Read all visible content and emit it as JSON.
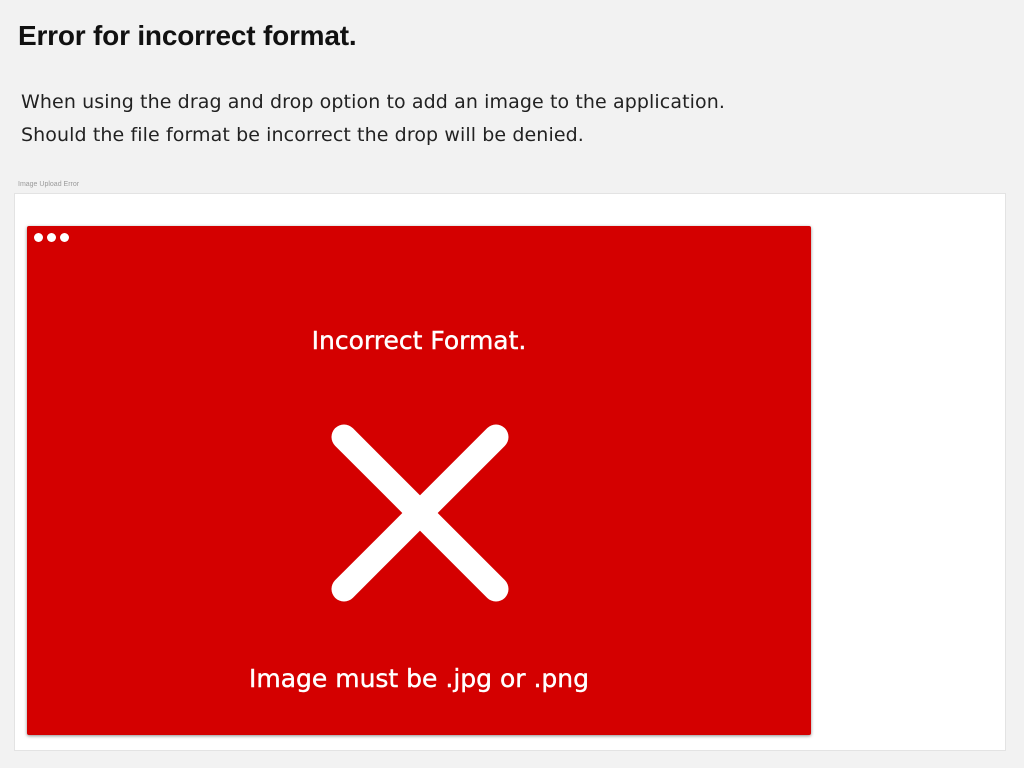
{
  "page": {
    "title": "Error for incorrect format.",
    "description_lines": [
      "When using the drag and drop option to add an image to the application.",
      "Should the file format be incorrect the drop will be denied."
    ]
  },
  "artboard": {
    "label": "Image Upload Error"
  },
  "error_window": {
    "heading": "Incorrect Format.",
    "icon": "close-x-icon",
    "message": "Image must be .jpg or .png",
    "background_color": "#d40000",
    "foreground_color": "#ffffff"
  }
}
